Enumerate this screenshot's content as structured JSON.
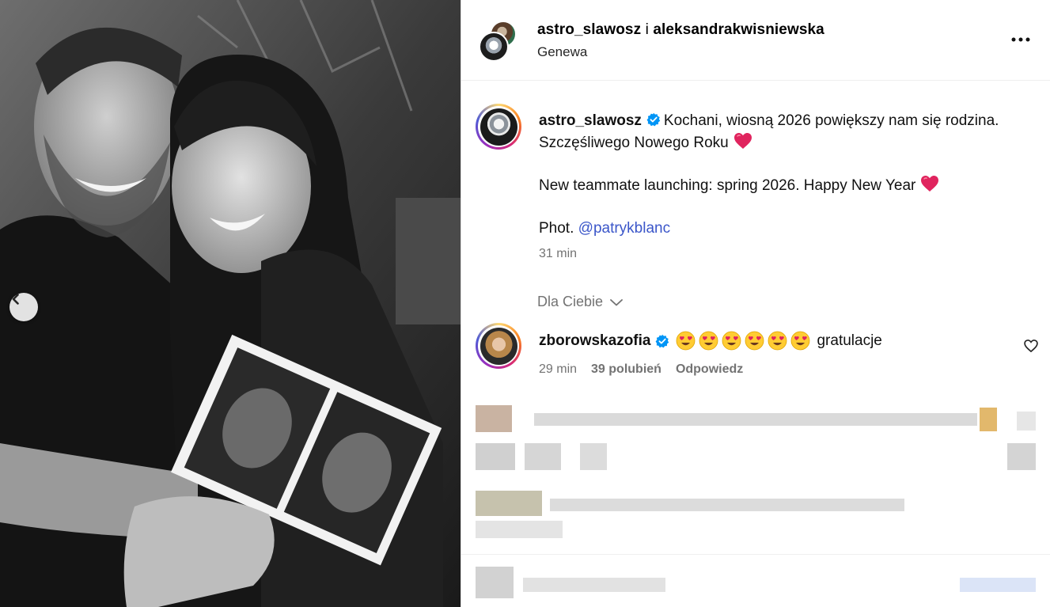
{
  "header": {
    "user_primary": "astro_slawosz",
    "joiner": "i",
    "user_secondary": "aleksandrakwisniewska",
    "location": "Genewa"
  },
  "caption": {
    "username": "astro_slawosz",
    "line1": "Kochani, wiosną 2026 powiększy nam się rodzina.",
    "line2": "Szczęśliwego Nowego Roku",
    "line3": "New teammate launching: spring 2026. Happy New Year",
    "photo_prefix": "Phot.",
    "mention": "@patrykblanc",
    "time": "31 min"
  },
  "filter_label": "Dla Ciebie",
  "comment": {
    "username": "zborowskazofia",
    "text": "gratulacje",
    "time": "29 min",
    "likes": "39 polubień",
    "reply": "Odpowiedz",
    "emoji_count": 6
  },
  "colors": {
    "verified": "#0095f6",
    "heart": "#e0245e",
    "mention": "#3b56c9",
    "muted": "#737373"
  },
  "icons": {
    "more": "more-horizontal-icon",
    "prev": "chevron-left-icon",
    "verified": "verified-badge-icon",
    "like": "heart-outline-icon",
    "dropdown": "chevron-down-icon"
  }
}
